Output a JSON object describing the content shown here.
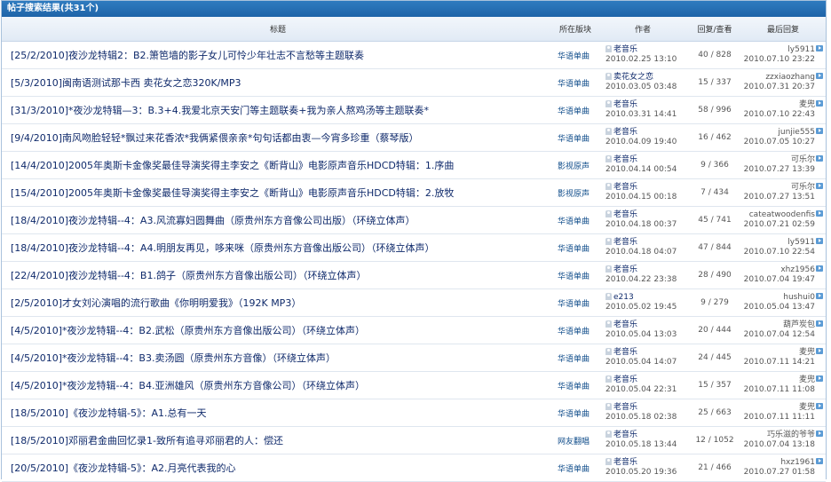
{
  "panel": {
    "title": "帖子搜索结果(共31个)"
  },
  "headers": {
    "title": "标题",
    "forum": "所在版块",
    "author": "作者",
    "stats": "回复/查看",
    "last": "最后回复"
  },
  "rows": [
    {
      "title": "[25/2/2010]夜沙龙特辑2：B2.箫笆墙的影子女儿可怜少年壮志不言愁等主题联奏",
      "forum": "华语单曲",
      "author": "老音乐",
      "date": "2010.02.25 13:10",
      "stats": "40 / 828",
      "last_user": "ly5911",
      "last_date": "2010.07.10 23:22"
    },
    {
      "title": "[5/3/2010]闽南语测试那卡西 卖花女之恋320K/MP3",
      "forum": "华语单曲",
      "author": "卖花女之恋",
      "date": "2010.03.05 03:48",
      "stats": "15 / 337",
      "last_user": "zzxiaozhang",
      "last_date": "2010.07.31 20:37"
    },
    {
      "title": "[31/3/2010]*夜沙龙特辑—3：B.3+4.我爱北京天安门等主题联奏+我为亲人熬鸡汤等主题联奏*",
      "forum": "华语单曲",
      "author": "老音乐",
      "date": "2010.03.31 14:41",
      "stats": "58 / 996",
      "last_user": "麦兜",
      "last_date": "2010.07.10 22:43"
    },
    {
      "title": "[9/4/2010]南风吻脸轻轻*飘过来花香浓*我俩紧偎亲亲*句句话都由衷—今宵多珍重（蔡琴版）",
      "forum": "华语单曲",
      "author": "老音乐",
      "date": "2010.04.09 19:40",
      "stats": "16 / 462",
      "last_user": "junjie555",
      "last_date": "2010.07.05 10:27"
    },
    {
      "title": "[14/4/2010]2005年奥斯卡金像奖最佳导演奖得主李安之《断背山》电影原声音乐HDCD特辑：1.序曲",
      "forum": "影视原声",
      "author": "老音乐",
      "date": "2010.04.14 00:54",
      "stats": "9 / 366",
      "last_user": "可乐尔",
      "last_date": "2010.07.27 13:39"
    },
    {
      "title": "[15/4/2010]2005年奥斯卡金像奖最佳导演奖得主李安之《断背山》电影原声音乐HDCD特辑：2.放牧",
      "forum": "影视原声",
      "author": "老音乐",
      "date": "2010.04.15 00:18",
      "stats": "7 / 434",
      "last_user": "可乐尔",
      "last_date": "2010.07.27 13:51"
    },
    {
      "title": "[18/4/2010]夜沙龙特辑--4：A3.风流寡妇圆舞曲（原贵州东方音像公司出版）（环绕立体声）",
      "forum": "华语单曲",
      "author": "老音乐",
      "date": "2010.04.18 00:37",
      "stats": "45 / 741",
      "last_user": "cateatwoodenfis",
      "last_date": "2010.07.21 02:59"
    },
    {
      "title": "[18/4/2010]夜沙龙特辑--4：A4.明朋友再见，哆来咪（原贵州东方音像出版公司）（环绕立体声）",
      "forum": "华语单曲",
      "author": "老音乐",
      "date": "2010.04.18 04:07",
      "stats": "47 / 844",
      "last_user": "ly5911",
      "last_date": "2010.07.10 22:54"
    },
    {
      "title": "[22/4/2010]夜沙龙特辑--4：B1.鸽子（原贵州东方音像出版公司）（环绕立体声）",
      "forum": "华语单曲",
      "author": "老音乐",
      "date": "2010.04.22 23:38",
      "stats": "28 / 490",
      "last_user": "xhz1956",
      "last_date": "2010.07.04 19:47"
    },
    {
      "title": "[2/5/2010]才女刘沁演唱的流行歌曲《你明明爱我》（192K MP3）",
      "forum": "华语单曲",
      "author": "e213",
      "date": "2010.05.02 19:45",
      "stats": "9 / 279",
      "last_user": "hushui0",
      "last_date": "2010.05.04 13:47"
    },
    {
      "title": "[4/5/2010]*夜沙龙特辑--4：B2.武松（原贵州东方音像出版公司）（环绕立体声）",
      "forum": "华语单曲",
      "author": "老音乐",
      "date": "2010.05.04 13:03",
      "stats": "20 / 444",
      "last_user": "葫芦炭包",
      "last_date": "2010.07.04 12:54"
    },
    {
      "title": "[4/5/2010]*夜沙龙特辑--4：B3.卖汤圆（原贵州东方音像）（环绕立体声）",
      "forum": "华语单曲",
      "author": "老音乐",
      "date": "2010.05.04 14:07",
      "stats": "24 / 445",
      "last_user": "麦兜",
      "last_date": "2010.07.11 14:21"
    },
    {
      "title": "[4/5/2010]*夜沙龙特辑--4：B4.亚洲雄风（原贵州东方音像公司）（环绕立体声）",
      "forum": "华语单曲",
      "author": "老音乐",
      "date": "2010.05.04 22:31",
      "stats": "15 / 357",
      "last_user": "麦兜",
      "last_date": "2010.07.11 11:08"
    },
    {
      "title": "[18/5/2010]《夜沙龙特辑-5》：A1.总有一天",
      "forum": "华语单曲",
      "author": "老音乐",
      "date": "2010.05.18 02:38",
      "stats": "25 / 663",
      "last_user": "麦兜",
      "last_date": "2010.07.11 11:11"
    },
    {
      "title": "[18/5/2010]邓丽君金曲回忆录1-致所有追寻邓丽君的人：偿还",
      "forum": "网友翻唱",
      "author": "老音乐",
      "date": "2010.05.18 13:44",
      "stats": "12 / 1052",
      "last_user": "巧乐滋的爷爷",
      "last_date": "2010.07.04 13:18"
    },
    {
      "title": "[20/5/2010]《夜沙龙特辑-5》：A2.月亮代表我的心",
      "forum": "华语单曲",
      "author": "老音乐",
      "date": "2010.05.20 19:36",
      "stats": "21 / 466",
      "last_user": "hxz1961",
      "last_date": "2010.07.27 01:58"
    }
  ]
}
